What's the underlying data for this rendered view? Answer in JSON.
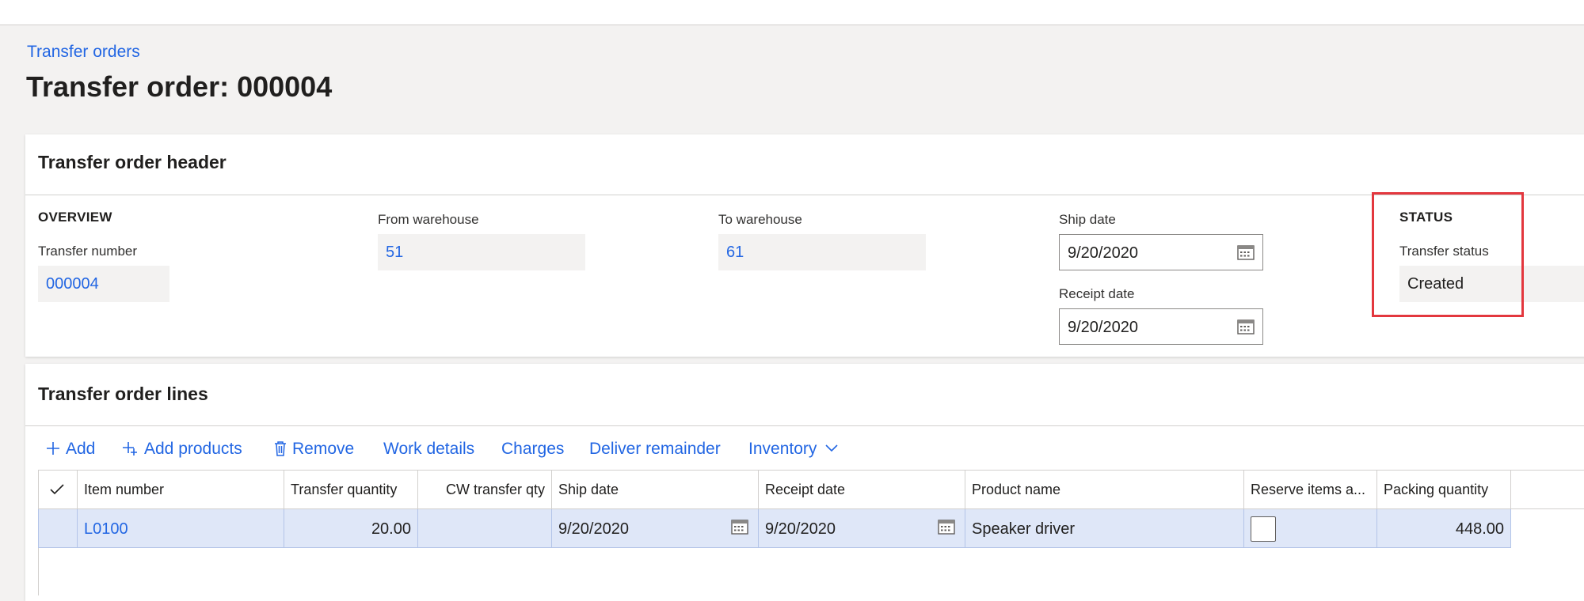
{
  "breadcrumb": "Transfer orders",
  "title": "Transfer order: 000004",
  "header": {
    "title": "Transfer order header",
    "overview": {
      "group_title": "OVERVIEW",
      "transfer_number_label": "Transfer number",
      "transfer_number": "000004"
    },
    "from_warehouse": {
      "label": "From warehouse",
      "value": "51"
    },
    "to_warehouse": {
      "label": "To warehouse",
      "value": "61"
    },
    "ship_date": {
      "label": "Ship date",
      "value": "9/20/2020"
    },
    "receipt_date": {
      "label": "Receipt date",
      "value": "9/20/2020"
    },
    "status": {
      "group_title": "STATUS",
      "transfer_status_label": "Transfer status",
      "transfer_status": "Created"
    }
  },
  "lines": {
    "title": "Transfer order lines",
    "toolbar": {
      "add": "Add",
      "add_products": "Add products",
      "remove": "Remove",
      "work_details": "Work details",
      "charges": "Charges",
      "deliver_remainder": "Deliver remainder",
      "inventory": "Inventory"
    },
    "columns": {
      "item_number": "Item number",
      "transfer_quantity": "Transfer quantity",
      "cw_transfer_qty": "CW transfer qty",
      "ship_date": "Ship date",
      "receipt_date": "Receipt date",
      "product_name": "Product name",
      "reserve_items": "Reserve items a...",
      "packing_quantity": "Packing quantity"
    },
    "rows": [
      {
        "item_number": "L0100",
        "transfer_quantity": "20.00",
        "cw_transfer_qty": "",
        "ship_date": "9/20/2020",
        "receipt_date": "9/20/2020",
        "product_name": "Speaker driver",
        "reserve_items": false,
        "packing_quantity": "448.00"
      }
    ]
  },
  "colors": {
    "link": "#2266e3",
    "highlight": "#e3373e",
    "selected_row": "#dfe7f8",
    "background": "#f3f2f1"
  },
  "icons": [
    "add-icon",
    "add-products-icon",
    "remove-icon",
    "chevron-down-icon",
    "calendar-icon",
    "checkmark-icon"
  ]
}
